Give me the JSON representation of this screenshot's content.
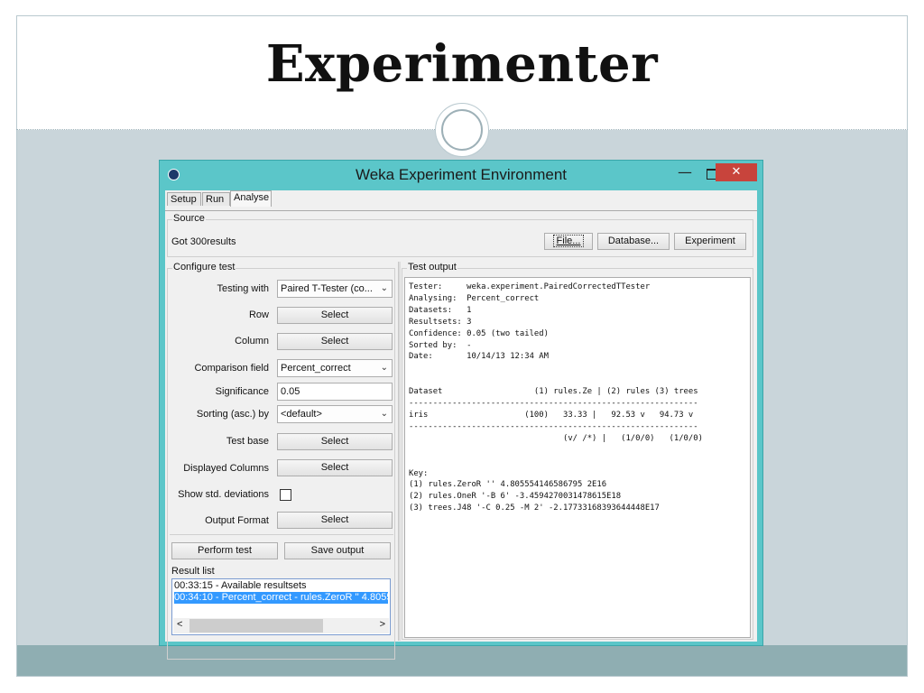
{
  "slide": {
    "title": "Experimenter"
  },
  "window": {
    "title": "Weka Experiment Environment",
    "minimize": "—",
    "close": "✕"
  },
  "tabs": [
    "Setup",
    "Run",
    "Analyse"
  ],
  "source": {
    "label": "Source",
    "status": "Got 300results",
    "file_button": "File...",
    "database_button": "Database...",
    "experiment_button": "Experiment"
  },
  "configure": {
    "label": "Configure test",
    "testing_with_label": "Testing with",
    "testing_with_value": "Paired T-Tester (co...",
    "row_label": "Row",
    "row_button": "Select",
    "column_label": "Column",
    "column_button": "Select",
    "comparison_label": "Comparison field",
    "comparison_value": "Percent_correct",
    "significance_label": "Significance",
    "significance_value": "0.05",
    "sorting_label": "Sorting (asc.) by",
    "sorting_value": "<default>",
    "test_base_label": "Test base",
    "test_base_button": "Select",
    "displayed_label": "Displayed Columns",
    "displayed_button": "Select",
    "show_std_label": "Show std. deviations",
    "show_std_checked": false,
    "output_format_label": "Output Format",
    "output_format_button": "Select",
    "perform_button": "Perform test",
    "save_button": "Save output"
  },
  "result_list": {
    "label": "Result list",
    "items": [
      "00:33:15 - Available resultsets",
      "00:34:10 - Percent_correct - rules.ZeroR '' 4.8055"
    ],
    "selected_index": 1,
    "scroll_left": "<",
    "scroll_right": ">"
  },
  "test_output": {
    "label": "Test output",
    "lines": [
      "Tester:     weka.experiment.PairedCorrectedTTester",
      "Analysing:  Percent_correct",
      "Datasets:   1",
      "Resultsets: 3",
      "Confidence: 0.05 (two tailed)",
      "Sorted by:  -",
      "Date:       10/14/13 12:34 AM",
      "",
      "",
      "Dataset                   (1) rules.Ze | (2) rules (3) trees",
      "------------------------------------------------------------",
      "iris                    (100)   33.33 |   92.53 v   94.73 v",
      "------------------------------------------------------------",
      "                                (v/ /*) |   (1/0/0)   (1/0/0)",
      "",
      "",
      "Key:",
      "(1) rules.ZeroR '' 4.805554146586795 2E16",
      "(2) rules.OneR '-B 6' -3.4594270031478615E18",
      "(3) trees.J48 '-C 0.25 -M 2' -2.17733168393644448E17"
    ]
  }
}
